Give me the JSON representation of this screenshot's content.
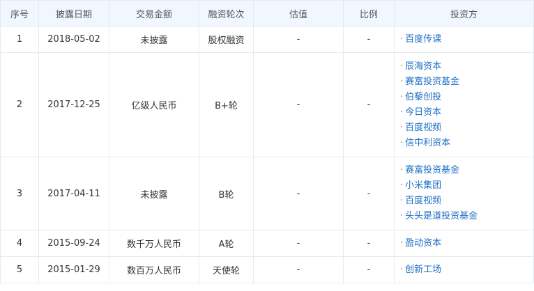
{
  "headers": [
    "序号",
    "披露日期",
    "交易金额",
    "融资轮次",
    "估值",
    "比例",
    "投资方"
  ],
  "rows": [
    {
      "no": "1",
      "date": "2018-05-02",
      "amount": "未披露",
      "round": "股权融资",
      "valuation": "-",
      "ratio": "-",
      "investors": [
        "百度传课"
      ]
    },
    {
      "no": "2",
      "date": "2017-12-25",
      "amount": "亿级人民币",
      "round": "B+轮",
      "valuation": "-",
      "ratio": "-",
      "investors": [
        "辰海资本",
        "赛富投资基金",
        "伯藜创投",
        "今日资本",
        "百度视频",
        "信中利资本"
      ]
    },
    {
      "no": "3",
      "date": "2017-04-11",
      "amount": "未披露",
      "round": "B轮",
      "valuation": "-",
      "ratio": "-",
      "investors": [
        "赛富投资基金",
        "小米集团",
        "百度视频",
        "头头是道投资基金"
      ]
    },
    {
      "no": "4",
      "date": "2015-09-24",
      "amount": "数千万人民币",
      "round": "A轮",
      "valuation": "-",
      "ratio": "-",
      "investors": [
        "盈动资本"
      ]
    },
    {
      "no": "5",
      "date": "2015-01-29",
      "amount": "数百万人民币",
      "round": "天使轮",
      "valuation": "-",
      "ratio": "-",
      "investors": [
        "创新工场"
      ]
    }
  ]
}
